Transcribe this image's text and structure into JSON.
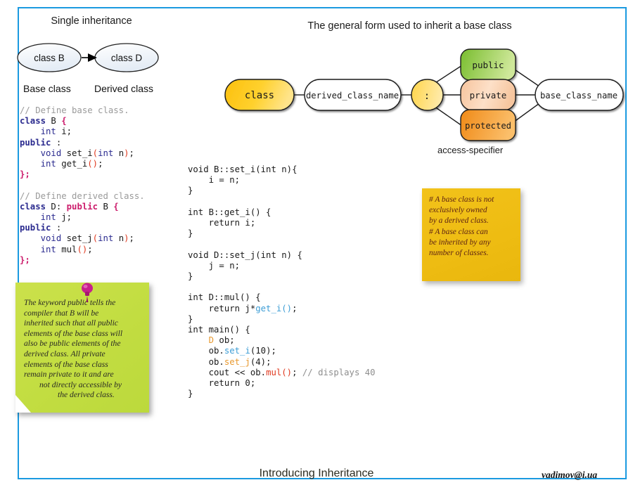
{
  "page": {
    "border_color": "#1b9ae0",
    "background": "#ffffff"
  },
  "single_inheritance": {
    "title": "Single inheritance",
    "base_node": "class B",
    "derived_node": "class D",
    "base_label": "Base class",
    "derived_label": "Derived class"
  },
  "general_form": {
    "title": "The general form used to inherit a base class",
    "nodes": {
      "class": "class",
      "derived_class_name": "derived_class_name",
      "colon": ":",
      "public": "public",
      "private": "private",
      "protected": "protected",
      "base_class_name": "base_class_name"
    },
    "access_specifier_label": "access-specifier",
    "colors": {
      "class_fill": "#ffc425",
      "colon_fill": "#ffd65c",
      "public_fill": "#8dc63f",
      "private_fill": "#f8c9a4",
      "protected_fill": "#f59b32",
      "plain_fill": "#ffffff",
      "stroke": "#1a1a1a"
    }
  },
  "code_left": {
    "lines": [
      {
        "segments": [
          {
            "t": "// Define base class.",
            "c": "c-com"
          }
        ]
      },
      {
        "segments": [
          {
            "t": "class",
            "c": "c-kw"
          },
          {
            "t": " B ",
            "c": ""
          },
          {
            "t": "{",
            "c": "c-brc"
          }
        ]
      },
      {
        "segments": [
          {
            "t": "    ",
            "c": ""
          },
          {
            "t": "int",
            "c": "c-typ"
          },
          {
            "t": " i;",
            "c": ""
          }
        ]
      },
      {
        "segments": [
          {
            "t": "public",
            "c": "c-kw"
          },
          {
            "t": " :",
            "c": ""
          }
        ]
      },
      {
        "segments": [
          {
            "t": "    ",
            "c": ""
          },
          {
            "t": "void",
            "c": "c-typ"
          },
          {
            "t": " set_i",
            "c": ""
          },
          {
            "t": "(",
            "c": "c-fn"
          },
          {
            "t": "int",
            "c": "c-typ"
          },
          {
            "t": " n",
            "c": ""
          },
          {
            "t": ")",
            "c": "c-fn"
          },
          {
            "t": ";",
            "c": ""
          }
        ]
      },
      {
        "segments": [
          {
            "t": "    ",
            "c": ""
          },
          {
            "t": "int",
            "c": "c-typ"
          },
          {
            "t": " get_i",
            "c": ""
          },
          {
            "t": "()",
            "c": "c-fn"
          },
          {
            "t": ";",
            "c": ""
          }
        ]
      },
      {
        "segments": [
          {
            "t": "};",
            "c": "c-brc"
          }
        ]
      },
      {
        "segments": [
          {
            "t": "",
            "c": ""
          }
        ]
      },
      {
        "segments": [
          {
            "t": "// Define derived class.",
            "c": "c-com"
          }
        ]
      },
      {
        "segments": [
          {
            "t": "class",
            "c": "c-kw"
          },
          {
            "t": " D: ",
            "c": ""
          },
          {
            "t": "public",
            "c": "c-pub"
          },
          {
            "t": " B ",
            "c": ""
          },
          {
            "t": "{",
            "c": "c-brc"
          }
        ]
      },
      {
        "segments": [
          {
            "t": "    ",
            "c": ""
          },
          {
            "t": "int",
            "c": "c-typ"
          },
          {
            "t": " j;",
            "c": ""
          }
        ]
      },
      {
        "segments": [
          {
            "t": "public",
            "c": "c-kw"
          },
          {
            "t": " :",
            "c": ""
          }
        ]
      },
      {
        "segments": [
          {
            "t": "    ",
            "c": ""
          },
          {
            "t": "void",
            "c": "c-typ"
          },
          {
            "t": " set_j",
            "c": ""
          },
          {
            "t": "(",
            "c": "c-fn"
          },
          {
            "t": "int",
            "c": "c-typ"
          },
          {
            "t": " n",
            "c": ""
          },
          {
            "t": ")",
            "c": "c-fn"
          },
          {
            "t": ";",
            "c": ""
          }
        ]
      },
      {
        "segments": [
          {
            "t": "    ",
            "c": ""
          },
          {
            "t": "int",
            "c": "c-typ"
          },
          {
            "t": " mul",
            "c": ""
          },
          {
            "t": "()",
            "c": "c-fn"
          },
          {
            "t": ";",
            "c": ""
          }
        ]
      },
      {
        "segments": [
          {
            "t": "};",
            "c": "c-brc"
          }
        ]
      }
    ]
  },
  "code_mid": {
    "lines": [
      {
        "segments": [
          {
            "t": "void B::set_i(int n){",
            "c": ""
          }
        ]
      },
      {
        "segments": [
          {
            "t": "    i = n;",
            "c": ""
          }
        ]
      },
      {
        "segments": [
          {
            "t": "}",
            "c": ""
          }
        ]
      },
      {
        "segments": [
          {
            "t": "",
            "c": ""
          }
        ]
      },
      {
        "segments": [
          {
            "t": "int B::get_i() {",
            "c": ""
          }
        ]
      },
      {
        "segments": [
          {
            "t": "    return i;",
            "c": ""
          }
        ]
      },
      {
        "segments": [
          {
            "t": "}",
            "c": ""
          }
        ]
      },
      {
        "segments": [
          {
            "t": "",
            "c": ""
          }
        ]
      },
      {
        "segments": [
          {
            "t": "void D::set_j(int n) {",
            "c": ""
          }
        ]
      },
      {
        "segments": [
          {
            "t": "    j = n;",
            "c": ""
          }
        ]
      },
      {
        "segments": [
          {
            "t": "}",
            "c": ""
          }
        ]
      },
      {
        "segments": [
          {
            "t": "",
            "c": ""
          }
        ]
      },
      {
        "segments": [
          {
            "t": "int D::mul() {",
            "c": ""
          }
        ]
      },
      {
        "segments": [
          {
            "t": "    return j*",
            "c": ""
          },
          {
            "t": "get_i()",
            "c": "c-fn2"
          },
          {
            "t": ";",
            "c": ""
          }
        ]
      },
      {
        "segments": [
          {
            "t": "}",
            "c": ""
          }
        ]
      },
      {
        "segments": [
          {
            "t": "int main() {",
            "c": ""
          }
        ]
      },
      {
        "segments": [
          {
            "t": "    ",
            "c": ""
          },
          {
            "t": "D",
            "c": "c-ora"
          },
          {
            "t": " ob;",
            "c": ""
          }
        ]
      },
      {
        "segments": [
          {
            "t": "    ob.",
            "c": ""
          },
          {
            "t": "set_i",
            "c": "c-fn2"
          },
          {
            "t": "(10);",
            "c": ""
          }
        ]
      },
      {
        "segments": [
          {
            "t": "    ob.",
            "c": ""
          },
          {
            "t": "set_j",
            "c": "c-ora"
          },
          {
            "t": "(4);",
            "c": ""
          }
        ]
      },
      {
        "segments": [
          {
            "t": "    cout << ob.",
            "c": ""
          },
          {
            "t": "mul()",
            "c": "c-red"
          },
          {
            "t": "; ",
            "c": ""
          },
          {
            "t": "// displays 40",
            "c": "c-grey"
          }
        ]
      },
      {
        "segments": [
          {
            "t": "    return 0;",
            "c": ""
          }
        ]
      },
      {
        "segments": [
          {
            "t": "}",
            "c": ""
          }
        ]
      }
    ]
  },
  "note_green": {
    "lines": [
      {
        "text": "The keyword public tells the",
        "indent": 0
      },
      {
        "text": "compiler that B will be",
        "indent": 0
      },
      {
        "text": "inherited such that all public",
        "indent": 0
      },
      {
        "text": "elements of the base class will",
        "indent": 0
      },
      {
        "text": "also be public elements of the",
        "indent": 0
      },
      {
        "text": "derived class. All private",
        "indent": 0
      },
      {
        "text": "elements of the base class",
        "indent": 0
      },
      {
        "text": "remain private to it and are",
        "indent": 0
      },
      {
        "text": "not directly accessible by",
        "indent": 1
      },
      {
        "text": "the derived class.",
        "indent": 2
      }
    ],
    "color": "#c2dd41",
    "pin_color": "#cc1f8f"
  },
  "note_yellow": {
    "lines": [
      "# A base class is not",
      "exclusively owned",
      "by a derived class.",
      "# A base class can",
      "be inherited by any",
      "number of classes."
    ],
    "color": "#eebc12",
    "text_color": "#5e2314"
  },
  "footer": {
    "title": "Introducing Inheritance",
    "email": "vadimov@i.ua"
  }
}
